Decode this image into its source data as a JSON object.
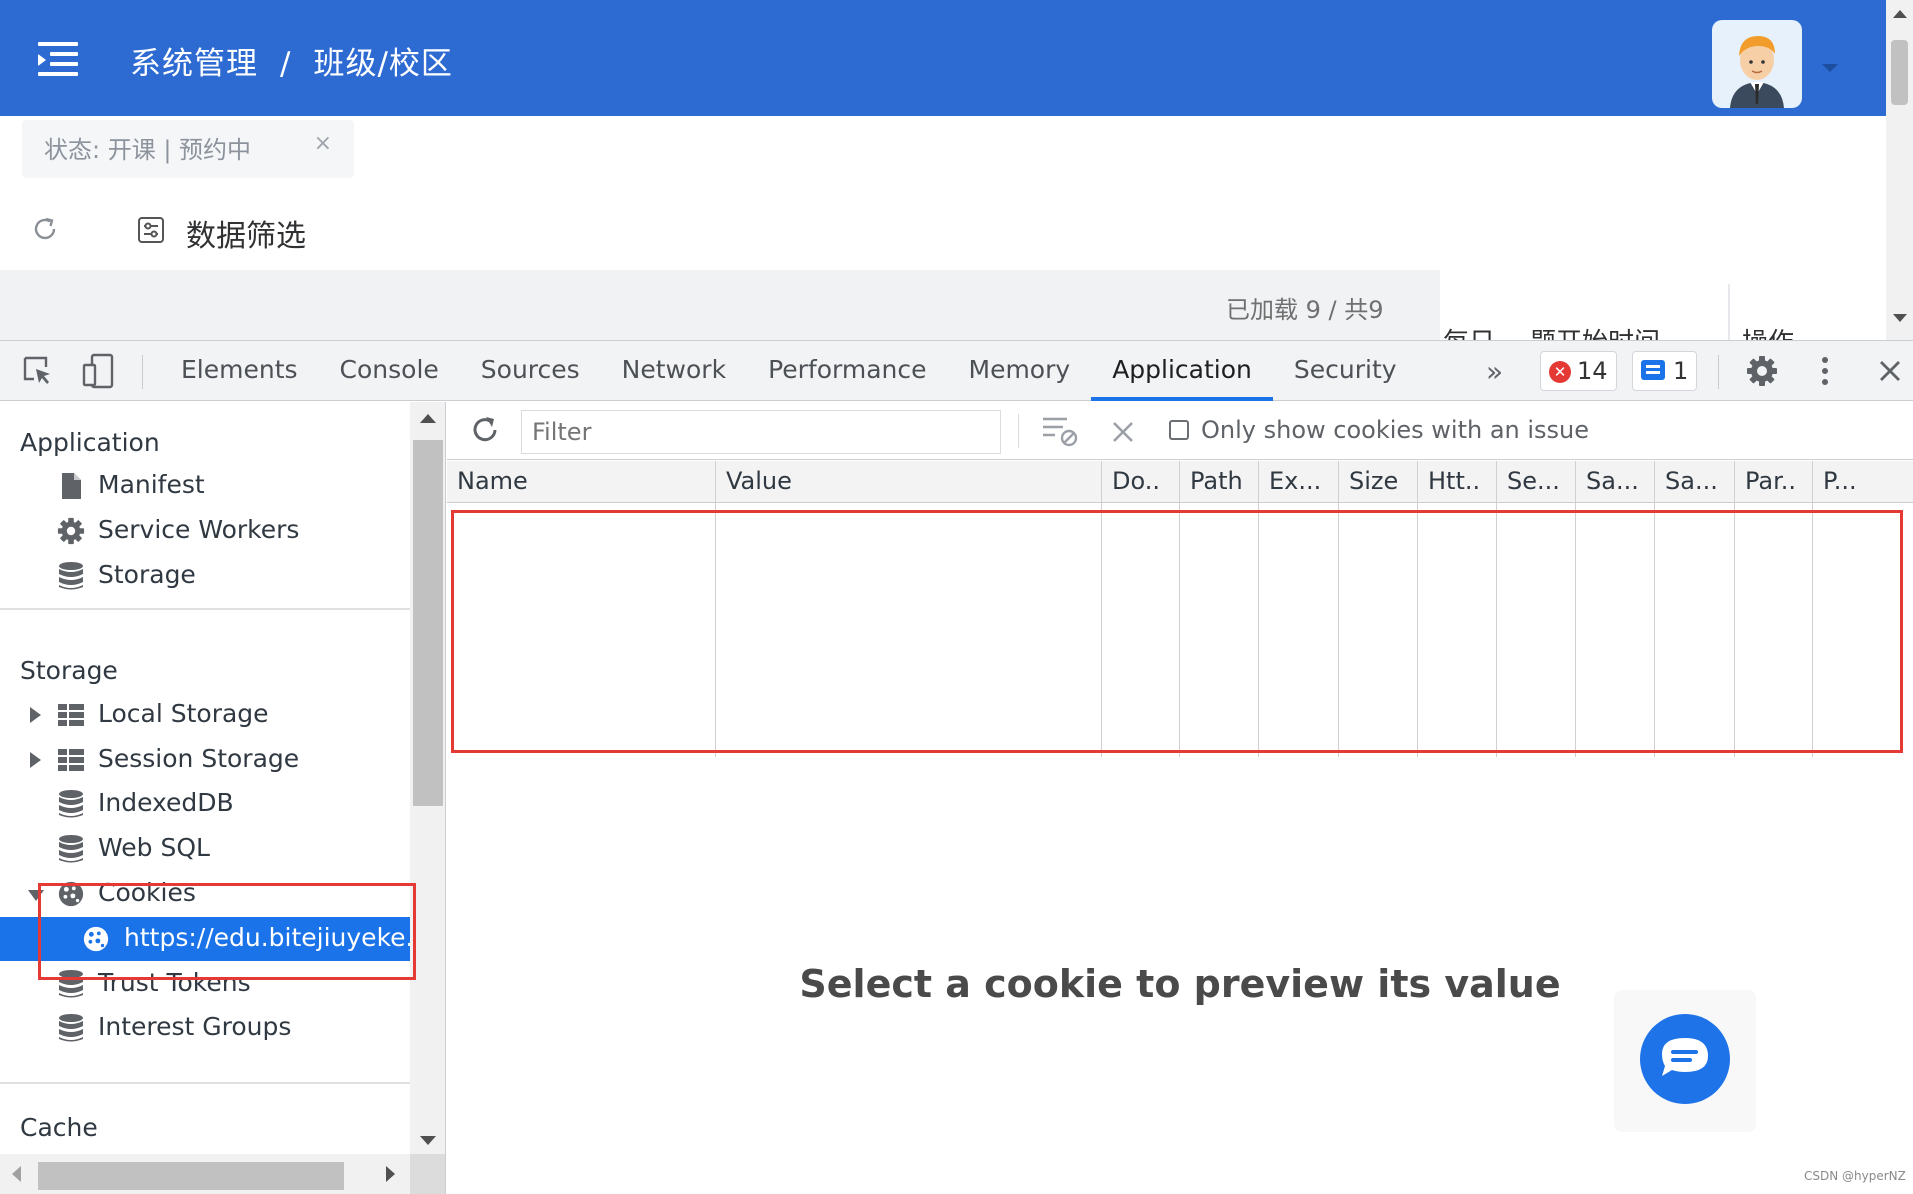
{
  "webpage": {
    "breadcrumb": [
      "系统管理",
      "/",
      "班级/校区"
    ],
    "filter_chip": "状态:  开课 | 预约中",
    "filter_chip_close": "×",
    "data_filter_label": "数据筛选",
    "loaded_count": "已加载 9 / 共9",
    "partial_columns": [
      "每日",
      "题开始时间",
      "操作"
    ]
  },
  "devtools": {
    "tabs": [
      "Elements",
      "Console",
      "Sources",
      "Network",
      "Performance",
      "Memory",
      "Application",
      "Security"
    ],
    "active_tab": "Application",
    "more_tabs": "»",
    "error_count": "14",
    "message_count": "1",
    "sidebar": {
      "application_title": "Application",
      "application_items": [
        "Manifest",
        "Service Workers",
        "Storage"
      ],
      "storage_title": "Storage",
      "storage_items": [
        "Local Storage",
        "Session Storage",
        "IndexedDB",
        "Web SQL",
        "Cookies"
      ],
      "cookie_origin": "https://edu.bitejiuyeke.c",
      "storage_items_after": [
        "Trust Tokens",
        "Interest Groups"
      ],
      "cache_title": "Cache"
    },
    "cookies": {
      "filter_placeholder": "Filter",
      "only_issue_label": "Only show cookies with an issue",
      "columns": [
        "Name",
        "Value",
        "Do..",
        "Path",
        "Ex...",
        "Size",
        "Htt..",
        "Se...",
        "Sa...",
        "Sa...",
        "Par..",
        "P..."
      ],
      "preview_message": "Select a cookie to preview its value"
    }
  },
  "watermark": "CSDN @hyperNZ",
  "colors": {
    "header_blue": "#2d6bd3",
    "devtools_accent": "#1a73e8",
    "highlight_red": "#e53935"
  }
}
